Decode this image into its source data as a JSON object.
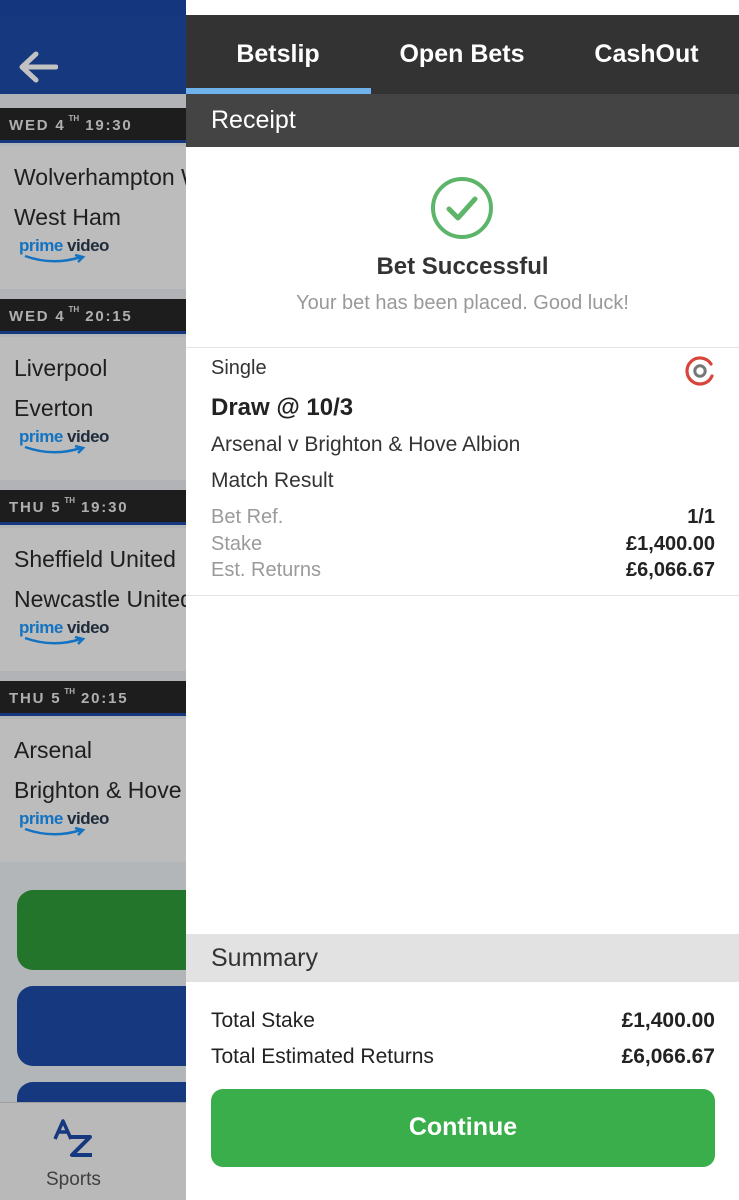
{
  "background": {
    "fixtures": [
      {
        "day": "WED 4",
        "suffix": "TH",
        "time": "19:30",
        "home": "Wolverhampton W",
        "away": "West Ham"
      },
      {
        "day": "WED 4",
        "suffix": "TH",
        "time": "20:15",
        "home": "Liverpool",
        "away": "Everton"
      },
      {
        "day": "THU 5",
        "suffix": "TH",
        "time": "19:30",
        "home": "Sheffield United",
        "away": "Newcastle United"
      },
      {
        "day": "THU 5",
        "suffix": "TH",
        "time": "20:15",
        "home": "Arsenal",
        "away": "Brighton & Hove"
      }
    ],
    "prime_video": {
      "part1": "prime ",
      "part2": "video"
    },
    "bottom_nav": {
      "sports_label": "Sports"
    }
  },
  "tabs": {
    "betslip": "Betslip",
    "open_bets": "Open Bets",
    "cashout": "CashOut"
  },
  "receipt": {
    "header": "Receipt",
    "title": "Bet Successful",
    "subtitle": "Your bet has been placed. Good luck!"
  },
  "bet": {
    "type": "Single",
    "selection": "Draw @ 10/3",
    "event": "Arsenal v Brighton & Hove Albion",
    "market": "Match Result",
    "ref_label": "Bet Ref.",
    "ref_value": "1/1",
    "stake_label": "Stake",
    "stake_value": "£1,400.00",
    "returns_label": "Est. Returns",
    "returns_value": "£6,066.67"
  },
  "summary": {
    "header": "Summary",
    "total_stake_label": "Total Stake",
    "total_stake_value": "£1,400.00",
    "total_returns_label": "Total Estimated Returns",
    "total_returns_value": "£6,066.67"
  },
  "continue_label": "Continue",
  "colors": {
    "accent_blue": "#1c4aa6",
    "success_green": "#3aae4a",
    "tab_indicator": "#6fb3ec",
    "dark_header": "#333333"
  }
}
